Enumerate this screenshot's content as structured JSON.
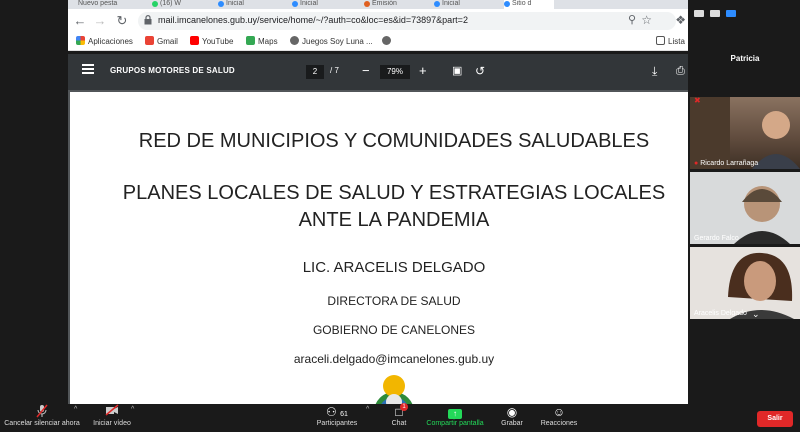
{
  "browser": {
    "tabs": [
      "Nuevo pesta",
      "(16) W",
      "Inicial",
      "Inicial",
      "Emisión",
      "Inicial",
      "Sitio d"
    ],
    "url": "mail.imcanelones.gub.uy/service/home/~/?auth=co&loc=es&id=73897&part=2",
    "bookmarks": [
      "Aplicaciones",
      "Gmail",
      "YouTube",
      "Maps",
      "Juegos Soy Luna ..."
    ],
    "reading_list": "Lista"
  },
  "pdf": {
    "title": "GRUPOS MOTORES DE SALUD",
    "page": "2",
    "page_sep": "/",
    "total_pages": "7",
    "zoom": "79%"
  },
  "document": {
    "heading": "RED DE MUNICIPIOS  Y COMUNIDADES SALUDABLES",
    "subheading_line1": "PLANES LOCALES DE SALUD Y ESTRATEGIAS LOCALES",
    "subheading_line2": "ANTE LA PANDEMIA",
    "author": "LIC. ARACELIS DELGADO",
    "role": "DIRECTORA DE SALUD",
    "organization": "GOBIERNO DE CANELONES",
    "email": "araceli.delgado@imcanelones.gub.uy"
  },
  "zoom": {
    "participants": [
      {
        "name": "Patricia"
      },
      {
        "name": "Ricardo Larrañaga"
      },
      {
        "name": "Gerardo Falco"
      },
      {
        "name": "Aracelis Delgado"
      }
    ],
    "controls": {
      "mute": "Cancelar silenciar ahora",
      "video": "Iniciar vídeo",
      "participants": "Participantes",
      "participant_count": "61",
      "chat": "Chat",
      "chat_badge": "1",
      "share": "Compartir pantalla",
      "record": "Grabar",
      "reactions": "Reacciones",
      "leave": "Salir"
    }
  },
  "colors": {
    "pdf_toolbar": "#323639",
    "share_green": "#23d959",
    "leave_red": "#e02828",
    "zoom_blue": "#2d8cff"
  }
}
